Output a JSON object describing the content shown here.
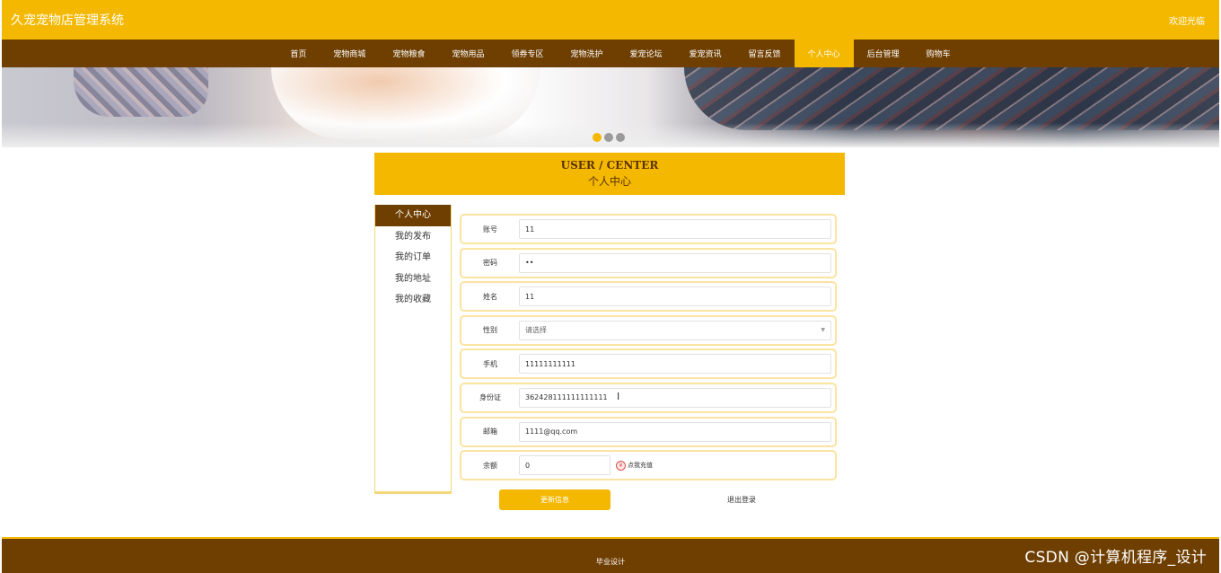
{
  "header": {
    "title": "久宠宠物店管理系统",
    "welcome": "欢迎光临"
  },
  "nav": {
    "items": [
      "首页",
      "宠物商城",
      "宠物粮食",
      "宠物用品",
      "领券专区",
      "宠物洗护",
      "爱宠论坛",
      "爱宠资讯",
      "留言反馈",
      "个人中心",
      "后台管理",
      "购物车"
    ],
    "active": "个人中心"
  },
  "banner": {
    "slide_count": 3,
    "active_slide": 1
  },
  "section": {
    "title_en": "USER / CENTER",
    "title_cn": "个人中心"
  },
  "sidebar": {
    "items": [
      "个人中心",
      "我的发布",
      "我的订单",
      "我的地址",
      "我的收藏"
    ],
    "active": "个人中心"
  },
  "form": {
    "account": {
      "label": "账号",
      "value": "11"
    },
    "password": {
      "label": "密码",
      "value": "••"
    },
    "name": {
      "label": "姓名",
      "value": "11"
    },
    "gender": {
      "label": "性别",
      "placeholder": "请选择"
    },
    "phone": {
      "label": "手机",
      "value": "11111111111"
    },
    "idcard": {
      "label": "身份证",
      "value": "362428111111111111"
    },
    "email": {
      "label": "邮箱",
      "value": "1111@qq.com"
    },
    "balance": {
      "label": "余额",
      "value": "0",
      "recharge_label": "点我充值"
    }
  },
  "buttons": {
    "update": "更新信息",
    "logout": "退出登录"
  },
  "footer": {
    "text": "毕业设计"
  },
  "watermark": "CSDN @计算机程序_设计",
  "colors": {
    "accent": "#f4b800",
    "brown": "#6f3f02",
    "field_border": "#fbe3a0"
  }
}
